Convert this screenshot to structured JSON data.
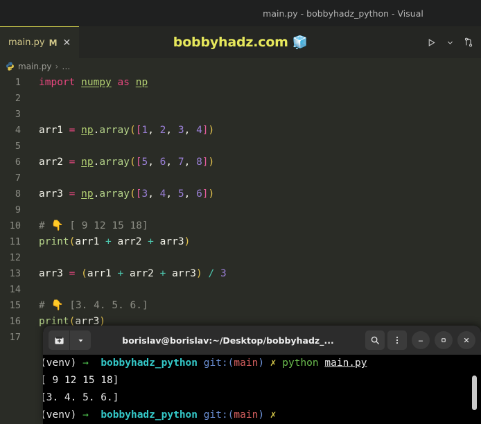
{
  "window": {
    "title": "main.py - bobbyhadz_python - Visual"
  },
  "tab": {
    "label": "main.py",
    "modified_badge": "M",
    "close_glyph": "✕"
  },
  "watermark": {
    "text": "bobbyhadz.com",
    "emoji": "🧊"
  },
  "editor_actions": [
    {
      "name": "run-python-file-button",
      "glyph": "▷"
    },
    {
      "name": "run-options-chevron-icon",
      "glyph": "⌄"
    },
    {
      "name": "split-editor-right-icon",
      "glyph": "⎇"
    }
  ],
  "breadcrumbs": {
    "file_icon": "python-logo-icon",
    "file": "main.py",
    "separator": "›",
    "ellipsis": "…"
  },
  "code": {
    "lines": [
      {
        "n": "1",
        "changed": true,
        "tokens": [
          {
            "t": "import",
            "c": "t-kw"
          },
          {
            "t": " ",
            "c": ""
          },
          {
            "t": "numpy",
            "c": "t-mod"
          },
          {
            "t": " ",
            "c": ""
          },
          {
            "t": "as",
            "c": "t-kw"
          },
          {
            "t": " ",
            "c": ""
          },
          {
            "t": "np",
            "c": "t-mod"
          }
        ]
      },
      {
        "n": "2",
        "changed": true,
        "tokens": []
      },
      {
        "n": "3",
        "changed": true,
        "tokens": []
      },
      {
        "n": "4",
        "changed": true,
        "tokens": [
          {
            "t": "arr1",
            "c": "t-var"
          },
          {
            "t": " ",
            "c": ""
          },
          {
            "t": "=",
            "c": "t-eq"
          },
          {
            "t": " ",
            "c": ""
          },
          {
            "t": "np",
            "c": "t-mod"
          },
          {
            "t": ".",
            "c": "t-dot"
          },
          {
            "t": "array",
            "c": "t-fn"
          },
          {
            "t": "(",
            "c": "t-p1"
          },
          {
            "t": "[",
            "c": "t-p2"
          },
          {
            "t": "1",
            "c": "t-num"
          },
          {
            "t": ", ",
            "c": "t-var"
          },
          {
            "t": "2",
            "c": "t-num"
          },
          {
            "t": ", ",
            "c": "t-var"
          },
          {
            "t": "3",
            "c": "t-num"
          },
          {
            "t": ", ",
            "c": "t-var"
          },
          {
            "t": "4",
            "c": "t-num"
          },
          {
            "t": "]",
            "c": "t-p2"
          },
          {
            "t": ")",
            "c": "t-p1"
          }
        ]
      },
      {
        "n": "5",
        "changed": true,
        "tokens": []
      },
      {
        "n": "6",
        "changed": true,
        "tokens": [
          {
            "t": "arr2",
            "c": "t-var"
          },
          {
            "t": " ",
            "c": ""
          },
          {
            "t": "=",
            "c": "t-eq"
          },
          {
            "t": " ",
            "c": ""
          },
          {
            "t": "np",
            "c": "t-mod"
          },
          {
            "t": ".",
            "c": "t-dot"
          },
          {
            "t": "array",
            "c": "t-fn"
          },
          {
            "t": "(",
            "c": "t-p1"
          },
          {
            "t": "[",
            "c": "t-p2"
          },
          {
            "t": "5",
            "c": "t-num"
          },
          {
            "t": ", ",
            "c": "t-var"
          },
          {
            "t": "6",
            "c": "t-num"
          },
          {
            "t": ", ",
            "c": "t-var"
          },
          {
            "t": "7",
            "c": "t-num"
          },
          {
            "t": ", ",
            "c": "t-var"
          },
          {
            "t": "8",
            "c": "t-num"
          },
          {
            "t": "]",
            "c": "t-p2"
          },
          {
            "t": ")",
            "c": "t-p1"
          }
        ]
      },
      {
        "n": "7",
        "changed": true,
        "tokens": []
      },
      {
        "n": "8",
        "changed": true,
        "tokens": [
          {
            "t": "arr3",
            "c": "t-var"
          },
          {
            "t": " ",
            "c": ""
          },
          {
            "t": "=",
            "c": "t-eq"
          },
          {
            "t": " ",
            "c": ""
          },
          {
            "t": "np",
            "c": "t-mod"
          },
          {
            "t": ".",
            "c": "t-dot"
          },
          {
            "t": "array",
            "c": "t-fn"
          },
          {
            "t": "(",
            "c": "t-p1"
          },
          {
            "t": "[",
            "c": "t-p2"
          },
          {
            "t": "3",
            "c": "t-num"
          },
          {
            "t": ", ",
            "c": "t-var"
          },
          {
            "t": "4",
            "c": "t-num"
          },
          {
            "t": ", ",
            "c": "t-var"
          },
          {
            "t": "5",
            "c": "t-num"
          },
          {
            "t": ", ",
            "c": "t-var"
          },
          {
            "t": "6",
            "c": "t-num"
          },
          {
            "t": "]",
            "c": "t-p2"
          },
          {
            "t": ")",
            "c": "t-p1"
          }
        ]
      },
      {
        "n": "9",
        "changed": false,
        "tokens": []
      },
      {
        "n": "10",
        "changed": true,
        "tokens": [
          {
            "t": "# ",
            "c": "t-comment"
          },
          {
            "t": "👇",
            "c": ""
          },
          {
            "t": " [ 9 12 15 18]",
            "c": "t-comment"
          }
        ]
      },
      {
        "n": "11",
        "changed": true,
        "tokens": [
          {
            "t": "print",
            "c": "t-fn"
          },
          {
            "t": "(",
            "c": "t-p1"
          },
          {
            "t": "arr1",
            "c": "t-var"
          },
          {
            "t": " ",
            "c": ""
          },
          {
            "t": "+",
            "c": "t-op"
          },
          {
            "t": " ",
            "c": ""
          },
          {
            "t": "arr2",
            "c": "t-var"
          },
          {
            "t": " ",
            "c": ""
          },
          {
            "t": "+",
            "c": "t-op"
          },
          {
            "t": " ",
            "c": ""
          },
          {
            "t": "arr3",
            "c": "t-var"
          },
          {
            "t": ")",
            "c": "t-p1"
          }
        ]
      },
      {
        "n": "12",
        "changed": false,
        "tokens": []
      },
      {
        "n": "13",
        "changed": true,
        "tokens": [
          {
            "t": "arr3",
            "c": "t-var"
          },
          {
            "t": " ",
            "c": ""
          },
          {
            "t": "=",
            "c": "t-eq"
          },
          {
            "t": " ",
            "c": ""
          },
          {
            "t": "(",
            "c": "t-p1"
          },
          {
            "t": "arr1",
            "c": "t-var"
          },
          {
            "t": " ",
            "c": ""
          },
          {
            "t": "+",
            "c": "t-op"
          },
          {
            "t": " ",
            "c": ""
          },
          {
            "t": "arr2",
            "c": "t-var"
          },
          {
            "t": " ",
            "c": ""
          },
          {
            "t": "+",
            "c": "t-op"
          },
          {
            "t": " ",
            "c": ""
          },
          {
            "t": "arr3",
            "c": "t-var"
          },
          {
            "t": ")",
            "c": "t-p1"
          },
          {
            "t": " ",
            "c": ""
          },
          {
            "t": "/",
            "c": "t-op"
          },
          {
            "t": " ",
            "c": ""
          },
          {
            "t": "3",
            "c": "t-num"
          }
        ]
      },
      {
        "n": "14",
        "changed": false,
        "tokens": []
      },
      {
        "n": "15",
        "changed": true,
        "tokens": [
          {
            "t": "# ",
            "c": "t-comment"
          },
          {
            "t": "👇",
            "c": ""
          },
          {
            "t": " [3. 4. 5. 6.]",
            "c": "t-comment"
          }
        ]
      },
      {
        "n": "16",
        "changed": true,
        "tokens": [
          {
            "t": "print",
            "c": "t-fn"
          },
          {
            "t": "(",
            "c": "t-p1"
          },
          {
            "t": "arr3",
            "c": "t-var"
          },
          {
            "t": ")",
            "c": "t-p1"
          }
        ]
      },
      {
        "n": "17",
        "changed": false,
        "tokens": []
      }
    ]
  },
  "terminal": {
    "title": "borislav@borislav:~/Desktop/bobbyhadz_...",
    "new_tab_glyph": "➕",
    "dropdown_glyph": "▾",
    "search_glyph": "⌕",
    "menu_glyph": "⋮",
    "minimize_glyph": "–",
    "maximize_glyph": "□",
    "close_glyph": "✕",
    "lines": [
      {
        "segments": [
          {
            "t": "(venv)",
            "c": "c-white"
          },
          {
            "t": " ",
            "c": ""
          },
          {
            "t": "→",
            "c": "c-green"
          },
          {
            "t": "  ",
            "c": ""
          },
          {
            "t": "bobbyhadz_python",
            "c": "c-cyan"
          },
          {
            "t": " ",
            "c": ""
          },
          {
            "t": "git:",
            "c": "c-blue"
          },
          {
            "t": "(",
            "c": "c-blue"
          },
          {
            "t": "main",
            "c": "c-red"
          },
          {
            "t": ")",
            "c": "c-blue"
          },
          {
            "t": " ",
            "c": ""
          },
          {
            "t": "✗",
            "c": "c-yellow"
          },
          {
            "t": " ",
            "c": ""
          },
          {
            "t": "python",
            "c": "c-pygreen"
          },
          {
            "t": " ",
            "c": ""
          },
          {
            "t": "main.py",
            "c": "c-uline"
          }
        ]
      },
      {
        "segments": [
          {
            "t": "[ 9 12 15 18]",
            "c": "c-white"
          }
        ]
      },
      {
        "segments": [
          {
            "t": "[3. 4. 5. 6.]",
            "c": "c-white"
          }
        ]
      },
      {
        "segments": [
          {
            "t": "(venv)",
            "c": "c-white"
          },
          {
            "t": " ",
            "c": ""
          },
          {
            "t": "→",
            "c": "c-green"
          },
          {
            "t": "  ",
            "c": ""
          },
          {
            "t": "bobbyhadz_python",
            "c": "c-cyan"
          },
          {
            "t": " ",
            "c": ""
          },
          {
            "t": "git:",
            "c": "c-blue"
          },
          {
            "t": "(",
            "c": "c-blue"
          },
          {
            "t": "main",
            "c": "c-red"
          },
          {
            "t": ")",
            "c": "c-blue"
          },
          {
            "t": " ",
            "c": ""
          },
          {
            "t": "✗",
            "c": "c-yellow"
          }
        ]
      }
    ]
  }
}
